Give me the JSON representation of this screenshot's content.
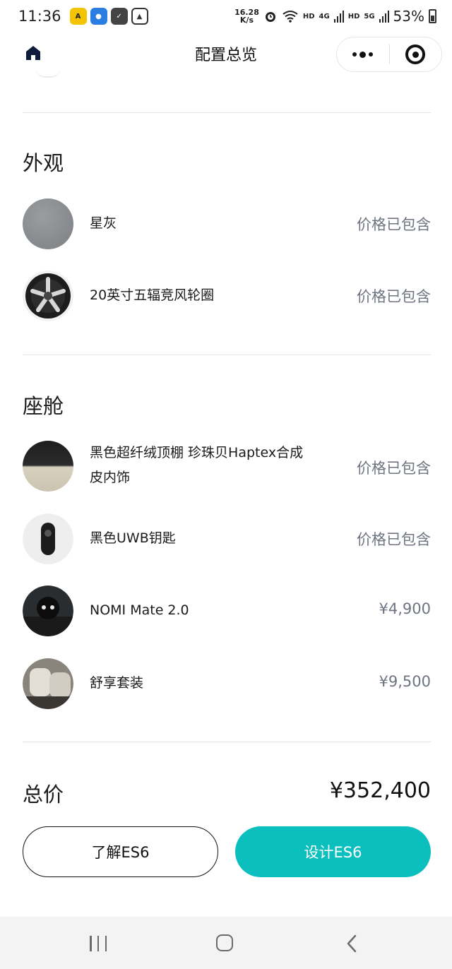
{
  "status_bar": {
    "time": "11:36",
    "speed_value": "16.28",
    "speed_unit": "K/s",
    "hd1": "HD",
    "net1": "4G",
    "hd2": "HD",
    "net2": "5G",
    "battery": "53%"
  },
  "nav": {
    "title": "配置总览"
  },
  "sections": {
    "exterior_title": "外观",
    "cabin_title": "座舱"
  },
  "exterior_items": [
    {
      "name": "星灰",
      "price": "价格已包含"
    },
    {
      "name": "20英寸五辐竞风轮圈",
      "price": "价格已包含"
    }
  ],
  "cabin_items": [
    {
      "name": "黑色超纤绒顶棚 珍珠贝Haptex合成皮内饰",
      "price": "价格已包含"
    },
    {
      "name": "黑色UWB钥匙",
      "price": "价格已包含"
    },
    {
      "name": "NOMI Mate 2.0",
      "price": "¥4,900"
    },
    {
      "name": "舒享套装",
      "price": "¥9,500"
    }
  ],
  "total": {
    "label": "总价",
    "value": "¥352,400"
  },
  "buttons": {
    "learn": "了解ES6",
    "design": "设计ES6"
  },
  "colors": {
    "accent": "#0bbfbe",
    "price_text": "#6e7480",
    "exterior_color": "#8a8d8f"
  },
  "icons": [
    "home-icon",
    "more-icon",
    "target-icon",
    "wifi-icon",
    "alarm-icon",
    "signal-icon",
    "battery-icon",
    "recent-apps-icon",
    "home-button-icon",
    "back-icon"
  ]
}
